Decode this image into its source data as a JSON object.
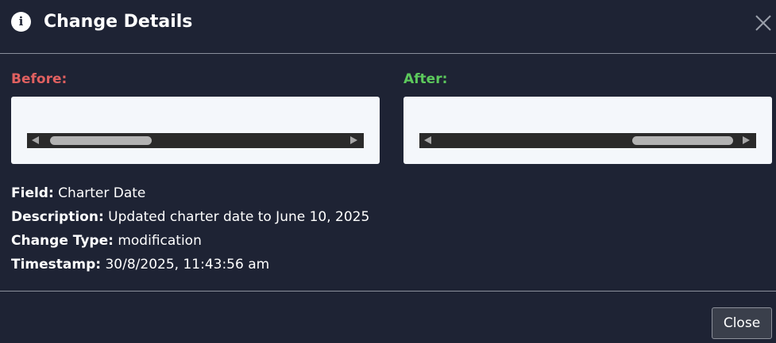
{
  "dialog": {
    "title": "Change Details",
    "info_icon": "info-icon",
    "info_glyph": "i",
    "close_icon": "close-icon"
  },
  "comparison": {
    "before_label": "Before:",
    "after_label": "After:",
    "before_color": "#e06060",
    "after_color": "#5cc95c"
  },
  "details": {
    "field_key": "Field:",
    "field_value": "Charter Date",
    "description_key": "Description:",
    "description_value": "Updated charter date to June 10, 2025",
    "change_type_key": "Change Type:",
    "change_type_value": "modification",
    "timestamp_key": "Timestamp:",
    "timestamp_value": "30/8/2025, 11:43:56 am"
  },
  "footer": {
    "close_label": "Close"
  }
}
